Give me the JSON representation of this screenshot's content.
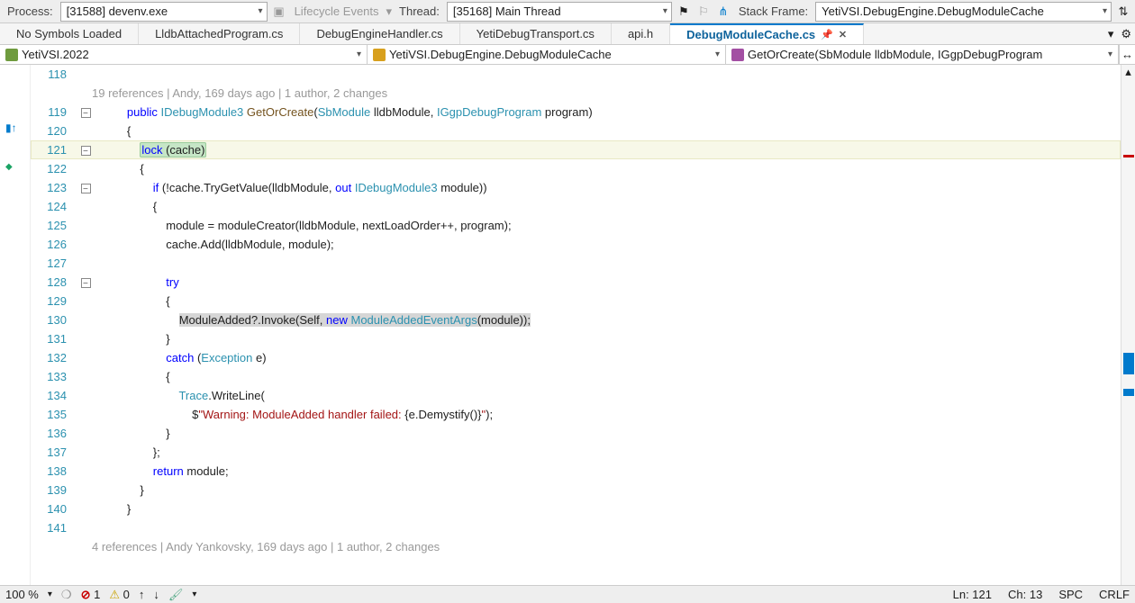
{
  "toolbar": {
    "process_label": "Process:",
    "process_value": "[31588] devenv.exe",
    "lifecycle_label": "Lifecycle Events",
    "thread_label": "Thread:",
    "thread_value": "[35168] Main Thread",
    "stackframe_label": "Stack Frame:",
    "stackframe_value": "YetiVSI.DebugEngine.DebugModuleCache"
  },
  "tabs": {
    "t0": "No Symbols Loaded",
    "t1": "LldbAttachedProgram.cs",
    "t2": "DebugEngineHandler.cs",
    "t3": "YetiDebugTransport.cs",
    "t4": "api.h",
    "t5": "DebugModuleCache.cs"
  },
  "nav": {
    "project": "YetiVSI.2022",
    "class": "YetiVSI.DebugEngine.DebugModuleCache",
    "member": "GetOrCreate(SbModule lldbModule, IGgpDebugProgram"
  },
  "codelens": {
    "top": "19 references | Andy, 169 days ago | 1 author, 2 changes",
    "bottom": "4 references | Andy Yankovsky, 169 days ago | 1 author, 2 changes"
  },
  "lines": {
    "n118": "118",
    "n119": "119",
    "n120": "120",
    "n121": "121",
    "n122": "122",
    "n123": "123",
    "n124": "124",
    "n125": "125",
    "n126": "126",
    "n127": "127",
    "n128": "128",
    "n129": "129",
    "n130": "130",
    "n131": "131",
    "n132": "132",
    "n133": "133",
    "n134": "134",
    "n135": "135",
    "n136": "136",
    "n137": "137",
    "n138": "138",
    "n139": "139",
    "n140": "140",
    "n141": "141"
  },
  "code": {
    "l119_pre": "        ",
    "l119_public": "public",
    "l119_sp1": " ",
    "l119_type1": "IDebugModule3",
    "l119_sp2": " ",
    "l119_meth": "GetOrCreate",
    "l119_paren": "(",
    "l119_type2": "SbModule",
    "l119_sp3": " lldbModule, ",
    "l119_type3": "IGgpDebugProgram",
    "l119_sp4": " program)",
    "l120": "        {",
    "l121_pre": "            ",
    "l121_lock": "lock (cache)",
    "l122": "            {",
    "l123_pre": "                ",
    "l123_if": "if",
    "l123_a": " (!cache.TryGetValue(lldbModule, ",
    "l123_out": "out",
    "l123_sp": " ",
    "l123_type": "IDebugModule3",
    "l123_b": " module))",
    "l124": "                {",
    "l125": "                    module = moduleCreator(lldbModule, nextLoadOrder++, program);",
    "l126": "                    cache.Add(lldbModule, module);",
    "l127": "",
    "l128_pre": "                    ",
    "l128_try": "try",
    "l129": "                    {",
    "l130_pre": "                        ",
    "l130_a": "ModuleAdded?.Invoke(Self, ",
    "l130_new": "new",
    "l130_sp": " ",
    "l130_type": "ModuleAddedEventArgs",
    "l130_b": "(module));",
    "l131": "                    }",
    "l132_pre": "                    ",
    "l132_catch": "catch",
    "l132_a": " (",
    "l132_type": "Exception",
    "l132_b": " e)",
    "l133": "                    {",
    "l134_pre": "                        ",
    "l134_type": "Trace",
    "l134_a": ".WriteLine(",
    "l135_pre": "                            $",
    "l135_str": "\"Warning: ModuleAdded handler failed: ",
    "l135_a": "{e.Demystify()}",
    "l135_str2": "\"",
    "l135_b": ");",
    "l136": "                    }",
    "l137": "                };",
    "l138_pre": "                ",
    "l138_ret": "return",
    "l138_a": " module;",
    "l139": "            }",
    "l140": "        }",
    "l141": ""
  },
  "status": {
    "zoom": "100 %",
    "errors": "1",
    "warnings": "0",
    "ln": "Ln: 121",
    "ch": "Ch: 13",
    "spc": "SPC",
    "crlf": "CRLF"
  }
}
